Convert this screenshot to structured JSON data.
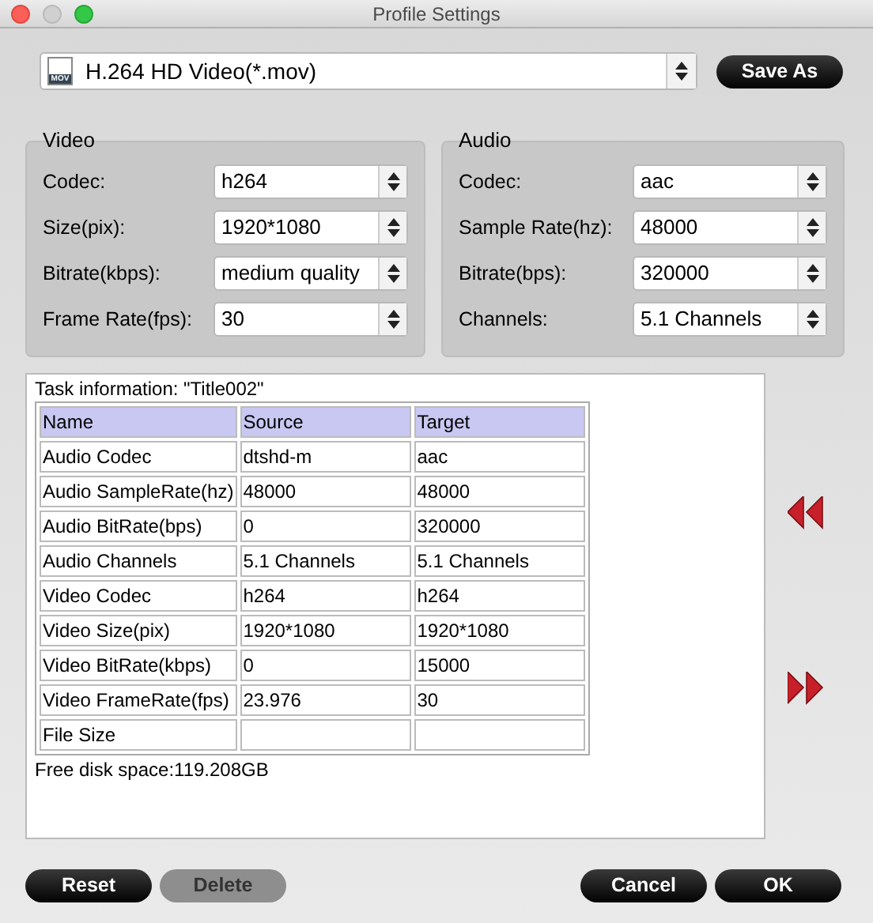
{
  "window": {
    "title": "Profile Settings"
  },
  "profile": {
    "value": "H.264 HD Video(*.mov)",
    "icon_label": "MOV"
  },
  "save_as": "Save As",
  "video": {
    "title": "Video",
    "fields": [
      {
        "label": "Codec:",
        "value": "h264"
      },
      {
        "label": "Size(pix):",
        "value": "1920*1080"
      },
      {
        "label": "Bitrate(kbps):",
        "value": "medium quality"
      },
      {
        "label": "Frame Rate(fps):",
        "value": "30"
      }
    ]
  },
  "audio": {
    "title": "Audio",
    "fields": [
      {
        "label": "Codec:",
        "value": "aac"
      },
      {
        "label": "Sample Rate(hz):",
        "value": "48000"
      },
      {
        "label": "Bitrate(bps):",
        "value": "320000"
      },
      {
        "label": "Channels:",
        "value": "5.1 Channels"
      }
    ]
  },
  "task": {
    "title": "Task information: \"Title002\"",
    "table": {
      "columns": [
        "Name",
        "Source",
        "Target"
      ],
      "rows": [
        [
          "Audio Codec",
          "dtshd-m",
          "aac"
        ],
        [
          "Audio SampleRate(hz)",
          "48000",
          "48000"
        ],
        [
          "Audio BitRate(bps)",
          "0",
          "320000"
        ],
        [
          "Audio Channels",
          "5.1 Channels",
          "5.1 Channels"
        ],
        [
          "Video Codec",
          "h264",
          "h264"
        ],
        [
          "Video Size(pix)",
          "1920*1080",
          "1920*1080"
        ],
        [
          "Video BitRate(kbps)",
          "0",
          "15000"
        ],
        [
          "Video FrameRate(fps)",
          "23.976",
          "30"
        ],
        [
          "File Size",
          "",
          ""
        ]
      ]
    },
    "free_space": "Free disk space:119.208GB"
  },
  "left_buttons": [
    {
      "label": "Reset",
      "disabled": false
    },
    {
      "label": "Delete",
      "disabled": true
    }
  ],
  "right_buttons": [
    {
      "label": "Cancel",
      "disabled": false
    },
    {
      "label": "OK",
      "disabled": false
    }
  ]
}
